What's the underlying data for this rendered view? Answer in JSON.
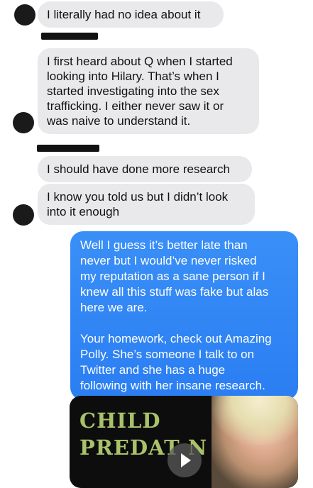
{
  "messages": {
    "m1": "I literally had no idea about it",
    "m2": "I first heard about Q when I started\nlooking into Hilary. That’s when I\nstarted investigating into the sex\ntrafficking. I either never saw it or\nwas naive to understand it.",
    "m3": "I should have done more research",
    "m4": "I know you told us but I didn’t look\ninto it enough",
    "m5": "Well I guess it’s better late than\nnever but I would’ve never risked\nmy reputation as a sane person if I\nknew all this stuff was fake but alas\nhere we are.\n\nYour homework, check out Amazing\nPolly. She’s someone I talk to on\nTwitter and she has a huge\nfollowing with her insane research."
  },
  "video": {
    "overlay_text": "CHILD\nPREDAT  N",
    "play_icon": "play-icon"
  },
  "colors": {
    "incoming_bubble": "#e9e9eb",
    "outgoing_bubble": "#2f8cf6",
    "video_text": "#a9c26a"
  }
}
